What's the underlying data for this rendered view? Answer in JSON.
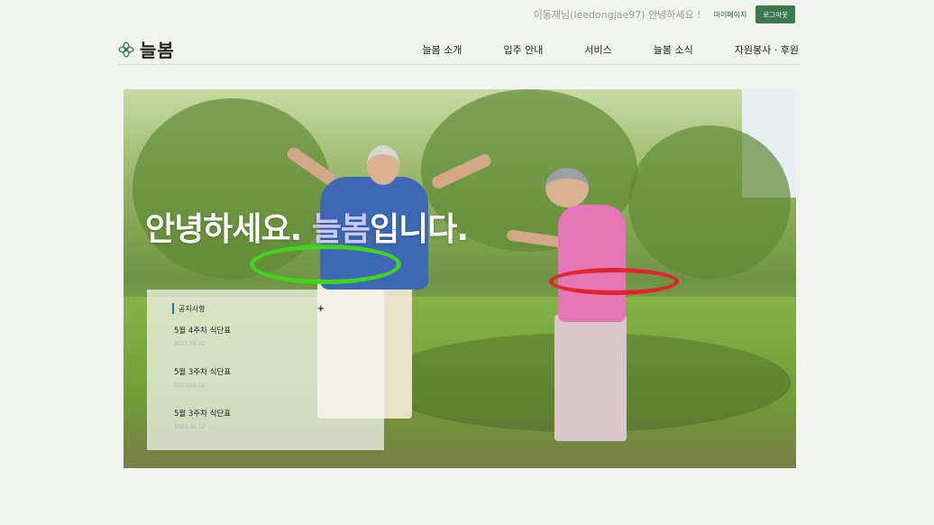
{
  "topbar": {
    "greeting": "이동재님(leedongjae97) 안녕하세요 !",
    "mypage_label": "마이페이지",
    "logout_label": "로그아웃"
  },
  "header": {
    "logo_text": "늘봄",
    "logo_icon": "clover-icon",
    "nav": [
      {
        "label": "늘봄 소개"
      },
      {
        "label": "입주 안내"
      },
      {
        "label": "서비스"
      },
      {
        "label": "늘봄 소식"
      },
      {
        "label": "자원봉사 · 후원"
      }
    ]
  },
  "hero": {
    "title_prefix": "안녕하세요. ",
    "title_brand": "늘봄",
    "title_suffix": "입니다.",
    "brand_color": "#c7c8f5"
  },
  "notice": {
    "title": "공지사항",
    "more_label": "+",
    "items": [
      {
        "title": "5월 4주차 식단표",
        "date": "2023.05.22"
      },
      {
        "title": "5월 3주차 식단표",
        "date": "2023.05.12"
      },
      {
        "title": "5월 3주차 식단표",
        "date": "2023.05.12"
      }
    ]
  },
  "colors": {
    "background": "#f1f3ee",
    "accent": "#3a7a4e",
    "notice_bar": "#2f6fa3"
  }
}
